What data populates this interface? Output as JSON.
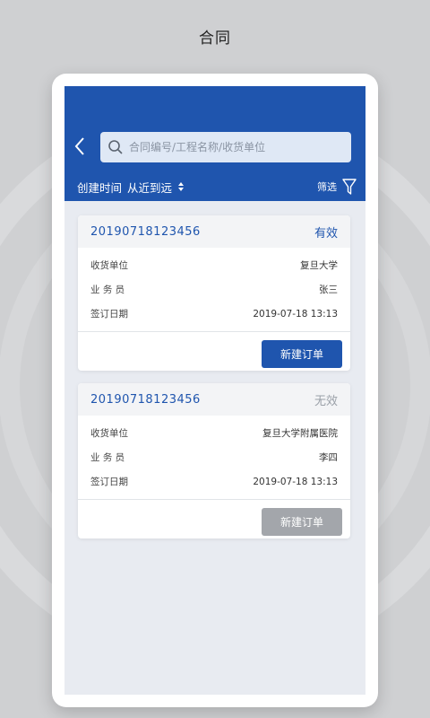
{
  "page_title": "合同",
  "search": {
    "placeholder": "合同编号/工程名称/收货单位"
  },
  "sort": {
    "by": "创建时间",
    "order": "从近到远"
  },
  "filter_label": "筛选",
  "contracts": [
    {
      "order_no": "20190718123456",
      "status": "有效",
      "status_color": "#1f55ae",
      "rows": [
        {
          "label": "收货单位",
          "value": "复旦大学"
        },
        {
          "label": "业 务 员",
          "value": "张三"
        },
        {
          "label": "签订日期",
          "value": "2019-07-18 13:13"
        }
      ],
      "action_label": "新建订单",
      "action_enabled": true
    },
    {
      "order_no": "20190718123456",
      "status": "无效",
      "status_color": "#9aa0a8",
      "rows": [
        {
          "label": "收货单位",
          "value": "复旦大学附属医院"
        },
        {
          "label": "业 务 员",
          "value": "李四"
        },
        {
          "label": "签订日期",
          "value": "2019-07-18 13:13"
        }
      ],
      "action_label": "新建订单",
      "action_enabled": false
    }
  ],
  "colors": {
    "primary": "#1f55ae",
    "disabled": "#a3a6ab",
    "background": "#e8ebf1"
  }
}
